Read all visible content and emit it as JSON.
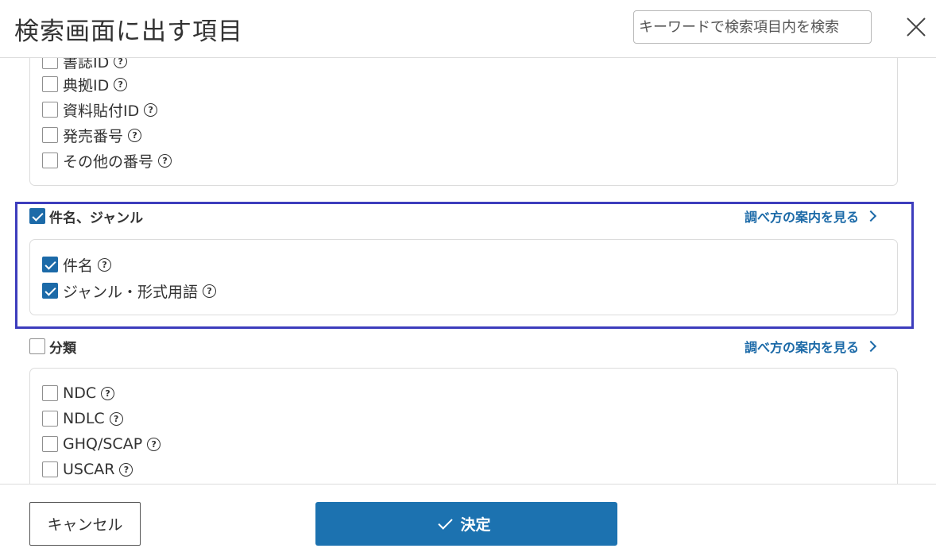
{
  "header": {
    "title": "検索画面に出す項目",
    "search_placeholder": "キーワードで検索項目内を検索",
    "close_icon": "close-icon"
  },
  "id_group": {
    "items": [
      {
        "label": "書誌ID",
        "checked": false
      },
      {
        "label": "典拠ID",
        "checked": false
      },
      {
        "label": "資料貼付ID",
        "checked": false
      },
      {
        "label": "発売番号",
        "checked": false
      },
      {
        "label": "その他の番号",
        "checked": false
      }
    ]
  },
  "title_group": {
    "label": "件名、ジャンル",
    "checked": true,
    "guide_link": "調べ方の案内を見る",
    "items": [
      {
        "label": "件名",
        "checked": true
      },
      {
        "label": "ジャンル・形式用語",
        "checked": true
      }
    ]
  },
  "class_group": {
    "label": "分類",
    "checked": false,
    "guide_link": "調べ方の案内を見る",
    "items": [
      {
        "label": "NDC",
        "checked": false
      },
      {
        "label": "NDLC",
        "checked": false
      },
      {
        "label": "GHQ/SCAP",
        "checked": false
      },
      {
        "label": "USCAR",
        "checked": false
      }
    ]
  },
  "help_icon": "?",
  "footer": {
    "cancel_label": "キャンセル",
    "confirm_label": "決定"
  },
  "colors": {
    "accent": "#1c72b0",
    "highlight_border": "#3d3dbd"
  }
}
